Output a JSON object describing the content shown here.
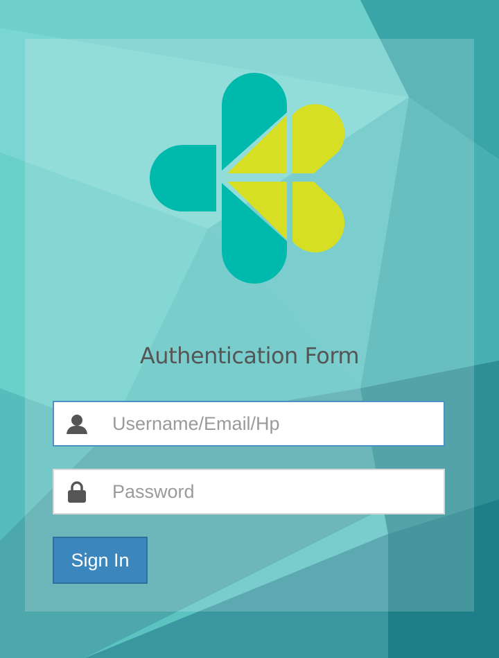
{
  "colors": {
    "logo_teal": "#00b9ad",
    "logo_yellow": "#d6df23",
    "button_blue": "#3a86bd",
    "title_gray": "#555555"
  },
  "form": {
    "title": "Authentication Form",
    "username": {
      "icon": "user-icon",
      "placeholder": "Username/Email/Hp",
      "value": ""
    },
    "password": {
      "icon": "lock-icon",
      "placeholder": "Password",
      "value": ""
    },
    "submit_label": "Sign In"
  }
}
